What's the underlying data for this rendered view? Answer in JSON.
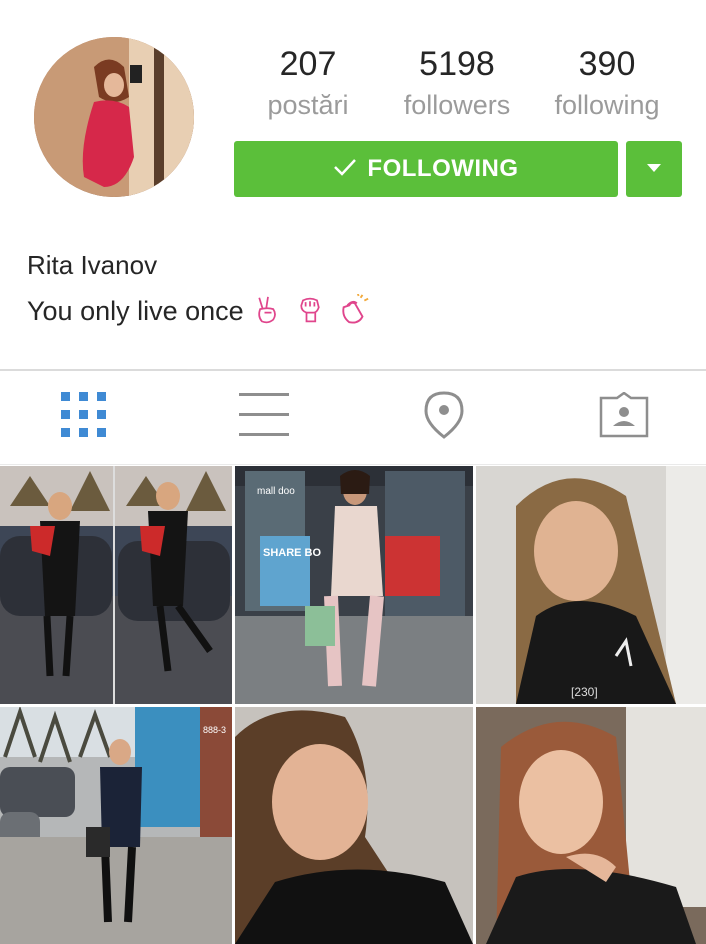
{
  "profile": {
    "name": "Rita Ivanov",
    "bio": "You only live once",
    "bio_emojis": [
      "victory-hand-emoji",
      "raised-fist-emoji",
      "clapping-hands-emoji"
    ]
  },
  "stats": [
    {
      "value": "207",
      "label": "postări"
    },
    {
      "value": "5198",
      "label": "followers"
    },
    {
      "value": "390",
      "label": "following"
    }
  ],
  "actions": {
    "follow_label": "FOLLOWING",
    "follow_icon": "checkmark-icon",
    "dropdown_icon": "caret-down-icon"
  },
  "tabs": [
    {
      "icon": "grid-icon",
      "active": true
    },
    {
      "icon": "list-icon",
      "active": false
    },
    {
      "icon": "location-pin-icon",
      "active": false
    },
    {
      "icon": "tagged-photos-icon",
      "active": false
    }
  ],
  "grid_labels": {
    "photo2_sign_top": "mall doo",
    "photo2_sign": "SHARE BO",
    "photo3_shirt": "[230]",
    "photo4_sign": "888-3"
  },
  "colors": {
    "accent_green": "#5bbf3a",
    "active_tab_blue": "#3f8ad4",
    "inactive_icon": "#8e8e8e",
    "emoji_pink": "#e0458c"
  }
}
